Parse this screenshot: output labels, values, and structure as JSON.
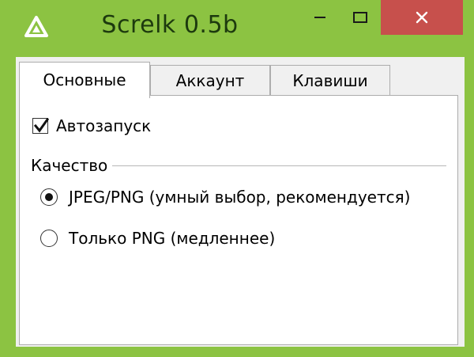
{
  "window": {
    "title": "Screlk 0.5b",
    "icon": "triangle-logo-icon",
    "controls": [
      "minimize-icon",
      "maximize-icon",
      "close-icon"
    ]
  },
  "tabs": [
    {
      "label": "Основные",
      "active": true
    },
    {
      "label": "Аккаунт",
      "active": false
    },
    {
      "label": "Клавиши",
      "active": false
    }
  ],
  "general": {
    "autostart": {
      "label": "Автозапуск",
      "checked": true
    },
    "quality": {
      "title": "Качество",
      "options": [
        {
          "label": "JPEG/PNG (умный выбор, рекомендуется)",
          "selected": true
        },
        {
          "label": "Только PNG (медленнее)",
          "selected": false
        }
      ]
    }
  },
  "colors": {
    "frame": "#8cc342",
    "close_button": "#c7504c",
    "title_text": "#1d3a0e"
  }
}
